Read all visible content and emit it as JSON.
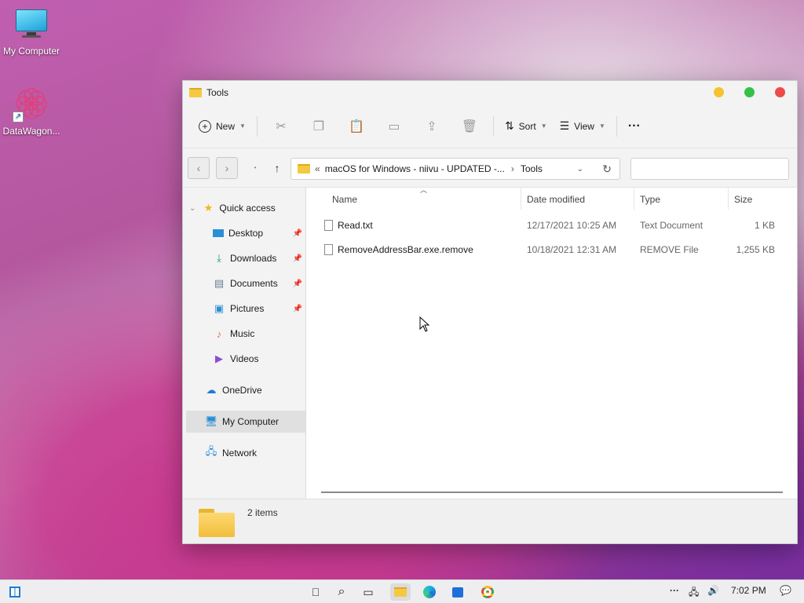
{
  "desktop": {
    "icons": [
      {
        "label": "My Computer",
        "icon": "monitor-icon"
      },
      {
        "label": "DataWagon...",
        "icon": "datawagon-icon"
      }
    ]
  },
  "window": {
    "title": "Tools",
    "traffic_colors": {
      "minimize": "#f5c330",
      "maximize": "#35c048",
      "close": "#ef4a4a"
    }
  },
  "toolbar": {
    "new_label": "New",
    "sort_label": "Sort",
    "view_label": "View",
    "more_label": "···"
  },
  "address": {
    "prefix": "«",
    "path": "macOS for Windows - niivu - UPDATED -...",
    "separator": "›",
    "current": "Tools"
  },
  "search": {
    "placeholder": ""
  },
  "sidebar": {
    "quick_access": "Quick access",
    "items": [
      {
        "label": "Desktop",
        "pinned": true
      },
      {
        "label": "Downloads",
        "pinned": true
      },
      {
        "label": "Documents",
        "pinned": true
      },
      {
        "label": "Pictures",
        "pinned": true
      },
      {
        "label": "Music",
        "pinned": false
      },
      {
        "label": "Videos",
        "pinned": false
      }
    ],
    "onedrive": "OneDrive",
    "my_computer": "My Computer",
    "network": "Network"
  },
  "filelist": {
    "columns": [
      "Name",
      "Date modified",
      "Type",
      "Size"
    ],
    "rows": [
      {
        "name": "Read.txt",
        "date": "12/17/2021 10:25 AM",
        "type": "Text Document",
        "size": "1 KB"
      },
      {
        "name": "RemoveAddressBar.exe.remove",
        "date": "10/18/2021 12:31 AM",
        "type": "REMOVE File",
        "size": "1,255 KB"
      }
    ]
  },
  "status": {
    "items_count": "2 items"
  },
  "taskbar": {
    "time": "7:02 PM",
    "more": "···"
  }
}
